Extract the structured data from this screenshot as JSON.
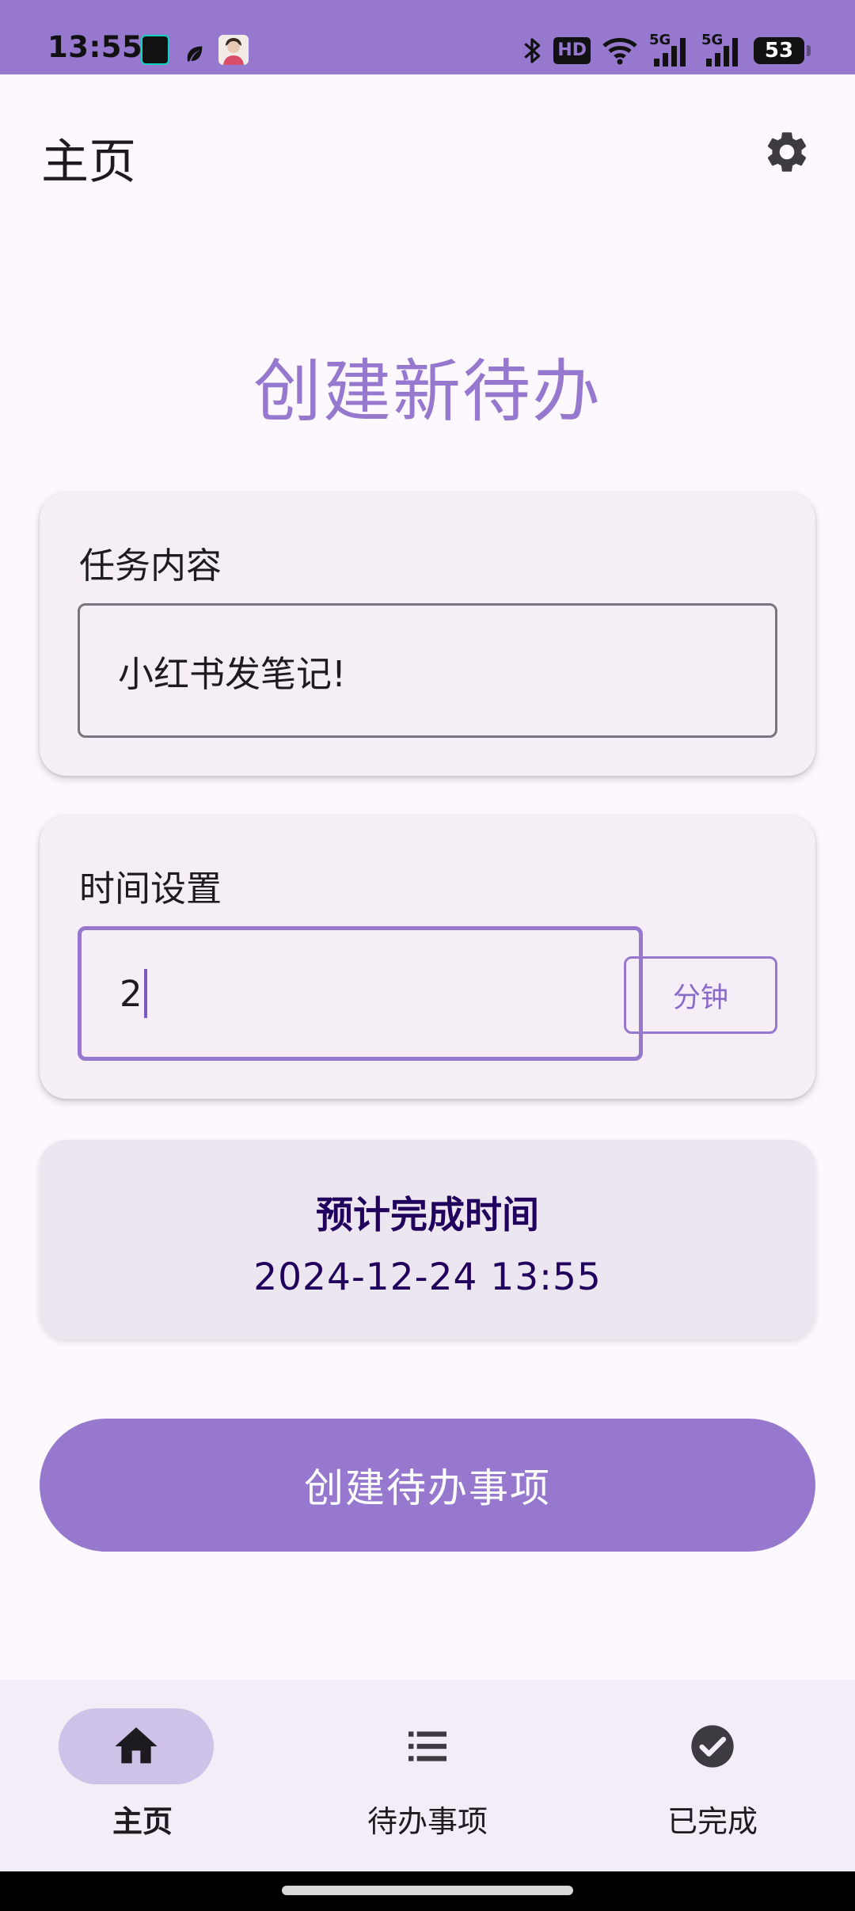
{
  "status_bar": {
    "time": "13:55",
    "hd_label": "HD",
    "network_1": "5G",
    "network_2": "5G",
    "battery": "53"
  },
  "header": {
    "title": "主页",
    "settings_icon": "gear-icon"
  },
  "page_heading": "创建新待办",
  "task_card": {
    "label": "任务内容",
    "input_value": "小红书发笔记!"
  },
  "time_card": {
    "label": "时间设置",
    "input_value": "2",
    "unit_button": "分钟"
  },
  "eta": {
    "title": "预计完成时间",
    "value": "2024-12-24 13:55"
  },
  "create_button": "创建待办事项",
  "bottom_nav": {
    "items": [
      {
        "label": "主页",
        "icon": "home-icon",
        "active": true
      },
      {
        "label": "待办事项",
        "icon": "list-icon",
        "active": false
      },
      {
        "label": "已完成",
        "icon": "check-circle-icon",
        "active": false
      }
    ]
  },
  "colors": {
    "primary": "#9778cf",
    "card": "#f5eef7",
    "eta_card": "#ece6f1",
    "eta_text": "#21005d",
    "nav_bg": "#f3edf7",
    "nav_active_pill": "#cfc2e8"
  }
}
